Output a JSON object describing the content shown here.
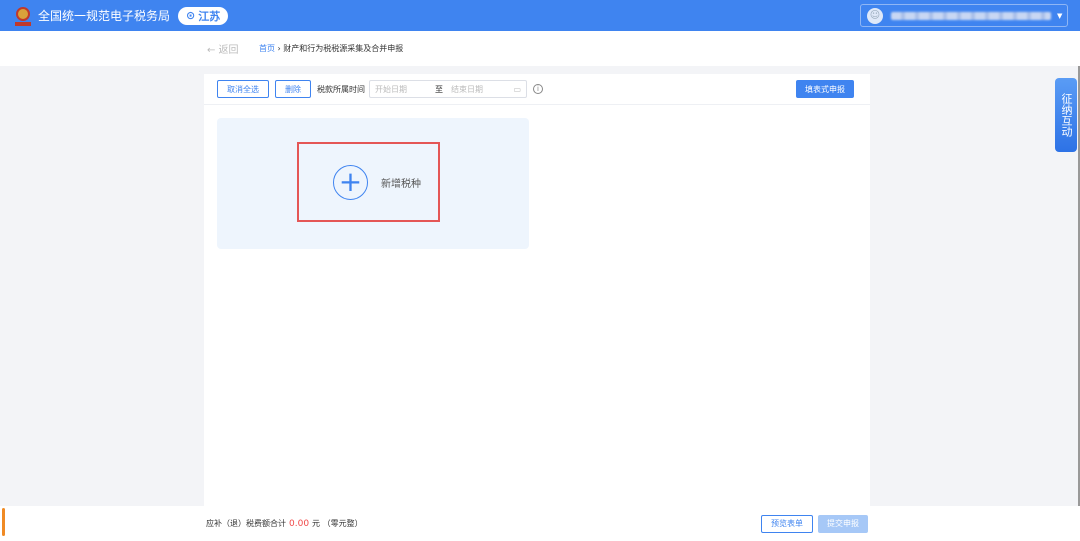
{
  "header": {
    "title": "全国统一规范电子税务局",
    "region": "江苏",
    "colors": {
      "brand": "#3f84f0"
    }
  },
  "breadcrumb": {
    "back": "← 返回",
    "home": "首页",
    "separator": "›",
    "current": "财产和行为税税源采集及合并申报"
  },
  "toolbar": {
    "deselect_all": "取消全选",
    "delete": "删除",
    "period_label": "税款所属时间",
    "start_placeholder": "开始日期",
    "to": "至",
    "end_placeholder": "结束日期",
    "fill_form": "填表式申报"
  },
  "card": {
    "add_label": "新增税种",
    "plus": "+"
  },
  "footer": {
    "total_label": "应补（退）税费额合计",
    "amount": "0.00",
    "unit": "元",
    "amount_words": "（零元整）",
    "preview": "预览表单",
    "submit": "提交申报"
  },
  "side": {
    "label": "征纳互动"
  }
}
